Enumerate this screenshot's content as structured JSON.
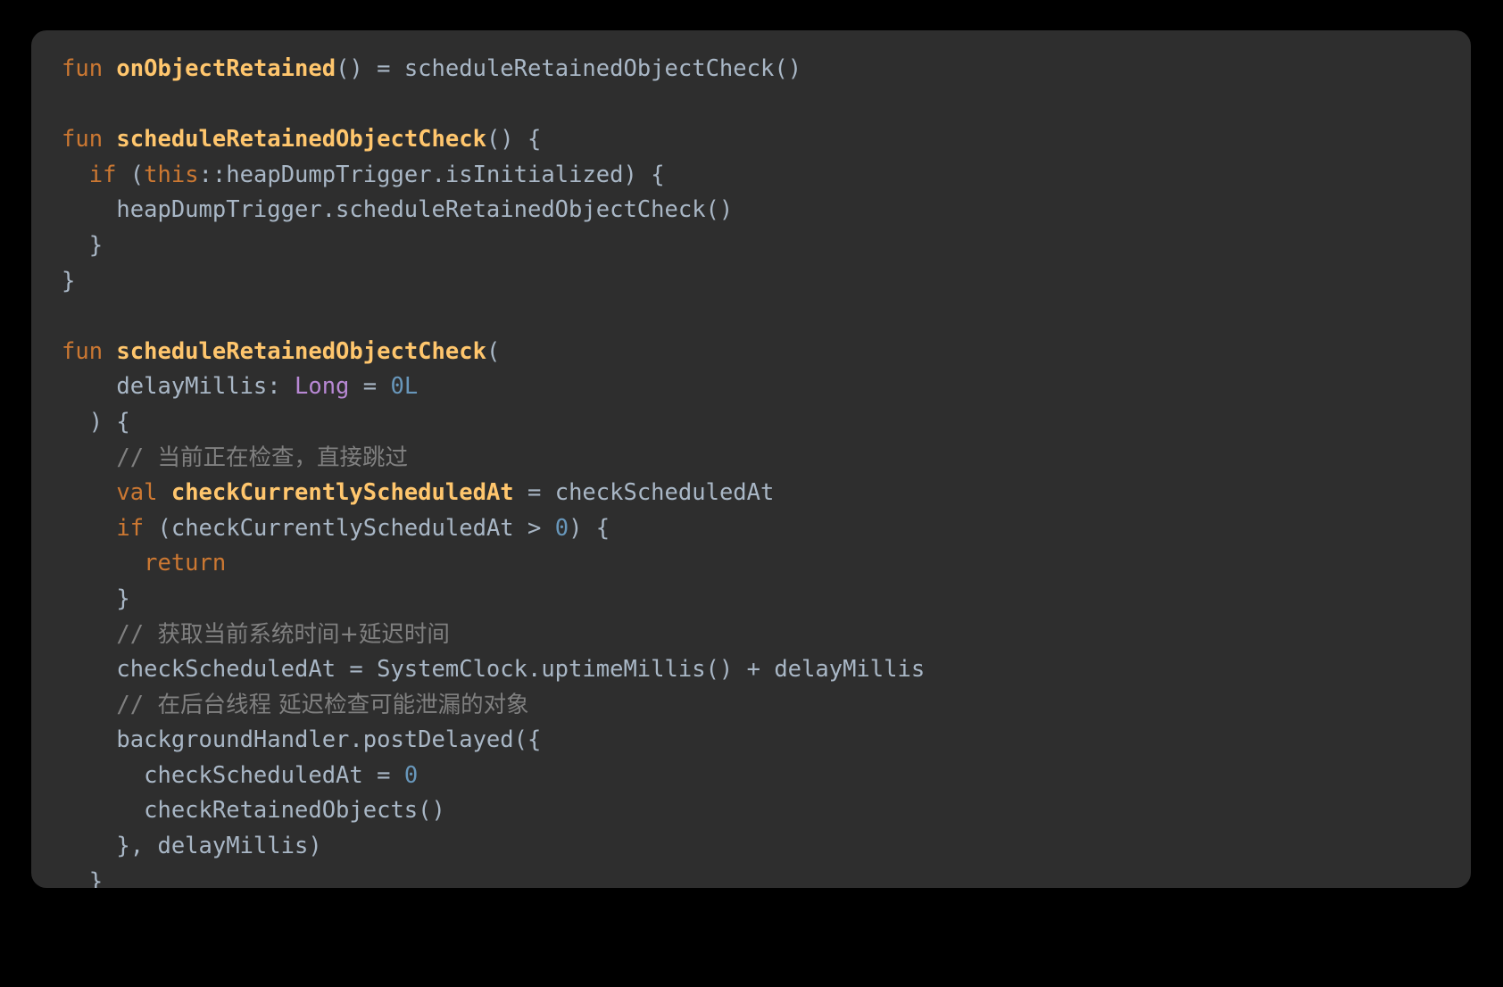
{
  "theme": {
    "page_background": "#000000",
    "panel_background": "#2e2e2e",
    "default_text": "#a9b7c6",
    "keyword": "#cc7832",
    "function_name": "#ffc66d",
    "type_name": "#b888d4",
    "number": "#6897bb",
    "comment": "#808080"
  },
  "code": {
    "language": "kotlin",
    "lines": [
      [
        {
          "t": "fun ",
          "c": "kw"
        },
        {
          "t": "onObjectRetained",
          "c": "fn"
        },
        {
          "t": "() = scheduleRetainedObjectCheck()",
          "c": "plain"
        }
      ],
      [],
      [
        {
          "t": "fun ",
          "c": "kw"
        },
        {
          "t": "scheduleRetainedObjectCheck",
          "c": "fn"
        },
        {
          "t": "() {",
          "c": "plain"
        }
      ],
      [
        {
          "t": "  ",
          "c": "plain"
        },
        {
          "t": "if",
          "c": "kw"
        },
        {
          "t": " (",
          "c": "plain"
        },
        {
          "t": "this",
          "c": "kw"
        },
        {
          "t": "::heapDumpTrigger.isInitialized) {",
          "c": "plain"
        }
      ],
      [
        {
          "t": "    heapDumpTrigger.scheduleRetainedObjectCheck()",
          "c": "plain"
        }
      ],
      [
        {
          "t": "  }",
          "c": "plain"
        }
      ],
      [
        {
          "t": "}",
          "c": "plain"
        }
      ],
      [],
      [
        {
          "t": "fun ",
          "c": "kw"
        },
        {
          "t": "scheduleRetainedObjectCheck",
          "c": "fn"
        },
        {
          "t": "(",
          "c": "plain"
        }
      ],
      [
        {
          "t": "    delayMillis: ",
          "c": "plain"
        },
        {
          "t": "Long",
          "c": "type"
        },
        {
          "t": " = ",
          "c": "plain"
        },
        {
          "t": "0L",
          "c": "num"
        }
      ],
      [
        {
          "t": "  ) {",
          "c": "plain"
        }
      ],
      [
        {
          "t": "    // ",
          "c": "cmt"
        },
        {
          "t": "当前正在检查，直接跳过",
          "c": "cmt cn"
        }
      ],
      [
        {
          "t": "    ",
          "c": "plain"
        },
        {
          "t": "val ",
          "c": "kw"
        },
        {
          "t": "checkCurrentlyScheduledAt",
          "c": "fn"
        },
        {
          "t": " = checkScheduledAt",
          "c": "plain"
        }
      ],
      [
        {
          "t": "    ",
          "c": "plain"
        },
        {
          "t": "if",
          "c": "kw"
        },
        {
          "t": " (checkCurrentlyScheduledAt > ",
          "c": "plain"
        },
        {
          "t": "0",
          "c": "num"
        },
        {
          "t": ") {",
          "c": "plain"
        }
      ],
      [
        {
          "t": "      ",
          "c": "plain"
        },
        {
          "t": "return",
          "c": "kw"
        }
      ],
      [
        {
          "t": "    }",
          "c": "plain"
        }
      ],
      [
        {
          "t": "    // ",
          "c": "cmt"
        },
        {
          "t": "获取当前系统时间+延迟时间",
          "c": "cmt cn"
        }
      ],
      [
        {
          "t": "    checkScheduledAt = SystemClock.uptimeMillis() + delayMillis",
          "c": "plain"
        }
      ],
      [
        {
          "t": "    // ",
          "c": "cmt"
        },
        {
          "t": "在后台线程 延迟检查可能泄漏的对象",
          "c": "cmt cn"
        }
      ],
      [
        {
          "t": "    backgroundHandler.postDelayed({",
          "c": "plain"
        }
      ],
      [
        {
          "t": "      checkScheduledAt = ",
          "c": "plain"
        },
        {
          "t": "0",
          "c": "num"
        }
      ],
      [
        {
          "t": "      checkRetainedObjects()",
          "c": "plain"
        }
      ],
      [
        {
          "t": "    }, delayMillis)",
          "c": "plain"
        }
      ],
      [
        {
          "t": "  }",
          "c": "plain"
        }
      ]
    ]
  }
}
